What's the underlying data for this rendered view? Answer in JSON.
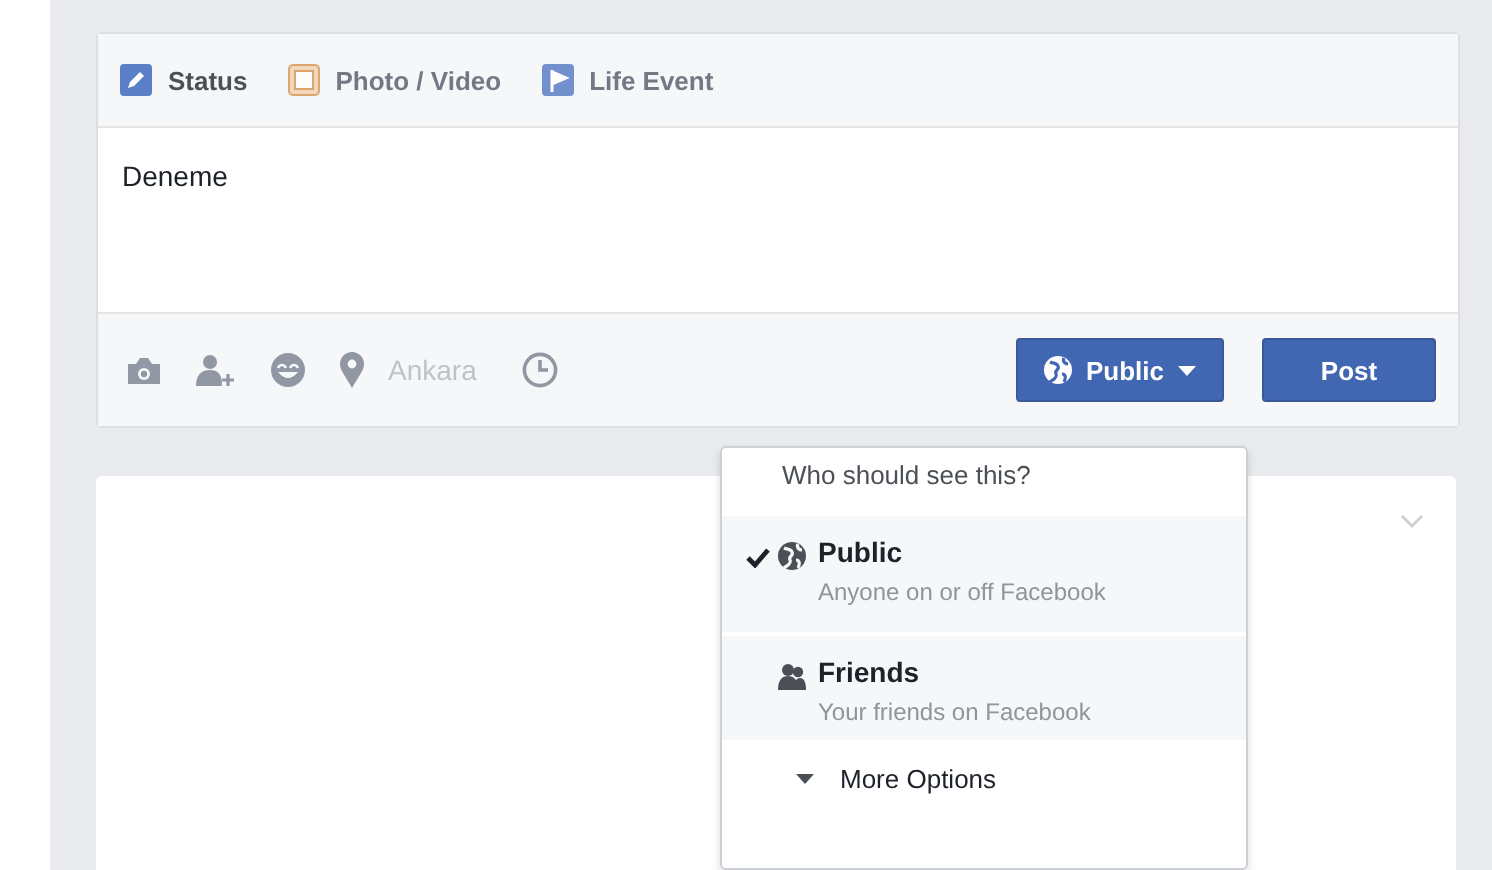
{
  "composer": {
    "tabs": [
      {
        "label": "Status",
        "kind": "status",
        "selected": true
      },
      {
        "label": "Photo / Video",
        "kind": "photo",
        "selected": false
      },
      {
        "label": "Life Event",
        "kind": "event",
        "selected": false
      }
    ],
    "text": "Deneme",
    "location": "Ankara",
    "audience_button": "Public",
    "post_button": "Post"
  },
  "audience_menu": {
    "heading": "Who should see this?",
    "options": [
      {
        "kind": "public",
        "label": "Public",
        "description": "Anyone on or off Facebook",
        "selected": true
      },
      {
        "kind": "friends",
        "label": "Friends",
        "description": "Your friends on Facebook",
        "selected": false
      }
    ],
    "more": "More Options"
  }
}
